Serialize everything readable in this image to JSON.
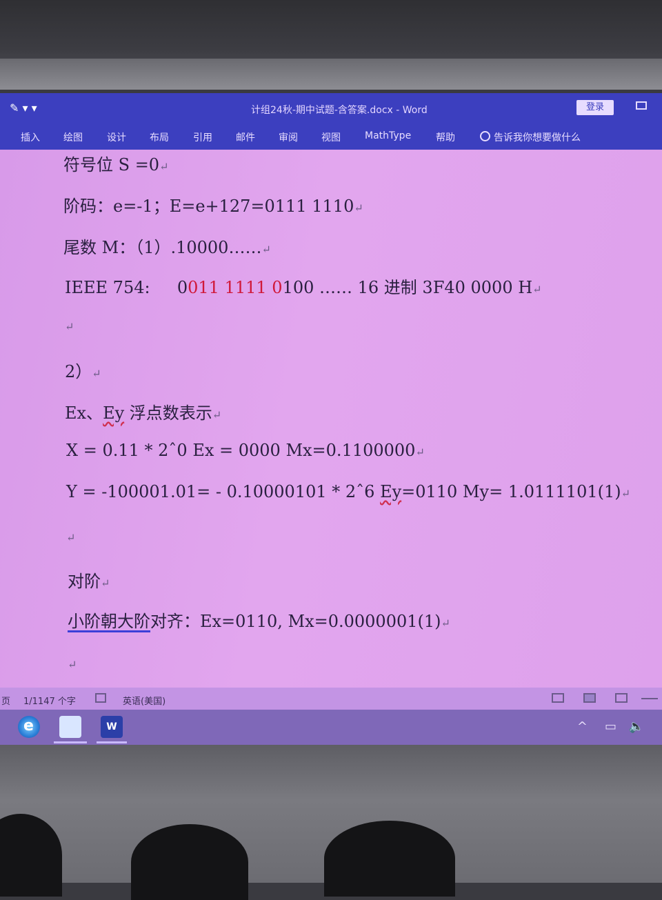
{
  "window": {
    "quick_access": "✎ ▾ ▾",
    "title": "计组24秋-期中试题-含答案.docx - Word",
    "login_label": "登录"
  },
  "ribbon": {
    "tabs": [
      "插入",
      "绘图",
      "设计",
      "布局",
      "引用",
      "邮件",
      "审阅",
      "视图",
      "MathType",
      "帮助"
    ],
    "tell_me": "告诉我你想要做什么"
  },
  "document": {
    "lines": {
      "sign": "符号位 S =0",
      "exponent": "阶码：e=-1；E=e+127=0111 1110",
      "mantissa": "尾数 M：（1）.10000……",
      "ieee_prefix": "IEEE 754:",
      "ieee_bits": [
        "0",
        "011",
        " 1111 ",
        "0",
        "100"
      ],
      "ieee_suffix": " ……   16 进制  3F40  0000  H",
      "part2": "2）",
      "float_rep_a": "Ex、",
      "float_rep_b": "Ey",
      "float_rep_c": " 浮点数表示",
      "x_line": "X = 0.11 * 2ˆ0    Ex = 0000    Mx=0.1100000",
      "y_line_a": "Y = -100001.01= - 0.10000101 * 2ˆ6    ",
      "y_line_b": "Ey",
      "y_line_c": "=0110 My= 1.0111101(1)",
      "align_heading": "对阶",
      "align_a": "小阶朝大阶",
      "align_b": "对齐：Ex=0110, Mx=0.0000001(1)"
    },
    "paragraph_mark": "↵"
  },
  "statusbar": {
    "page": "页",
    "words": "1/1147 个字",
    "language": "英语(美国)"
  },
  "taskbar": {
    "ie_glyph": "e",
    "word_glyph": "W",
    "tray": [
      "^",
      "▭",
      "🔈"
    ]
  },
  "colors": {
    "titlebar": "#3c3fbf",
    "page": "#e2a6ee",
    "red_bits": "#d01838"
  }
}
